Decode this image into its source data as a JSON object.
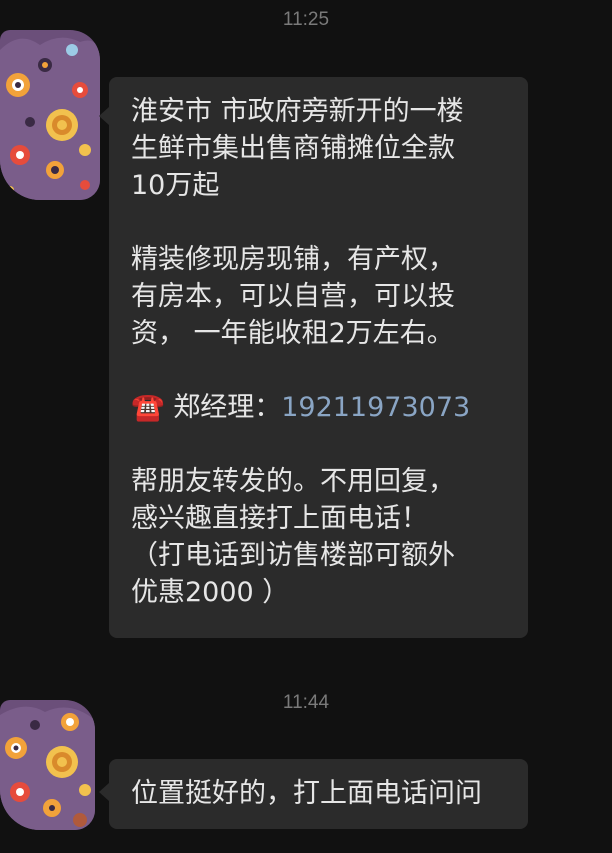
{
  "chat": {
    "timestamps": [
      "11:25",
      "11:44"
    ],
    "message_1": {
      "para1": [
        "淮安市 市政府旁新开的一楼",
        "生鲜市集出售商铺摊位全款",
        "10万起"
      ],
      "para2": [
        "精装修现房现铺，有产权，",
        "有房本，可以自营，可以投",
        "资， 一年能收租2万左右。"
      ],
      "contact": {
        "icon": "telephone-icon",
        "emoji": "☎️",
        "label": " 郑经理：",
        "phone": "19211973073"
      },
      "para3": [
        "帮朋友转发的。不用回复，",
        "感兴趣直接打上面电话！",
        "（打电话到访售楼部可额外",
        "优惠2000 ）"
      ]
    },
    "message_2": {
      "text": "位置挺好的，打上面电话问问"
    },
    "colors": {
      "background": "#111111",
      "bubble": "#2b2b2b",
      "text": "#e6e6e6",
      "link": "#8aa5c4",
      "timestamp": "#7a7a7a",
      "avatar_purple": "#6b4f7a"
    },
    "avatars": [
      "avatar-image",
      "avatar-image"
    ]
  }
}
